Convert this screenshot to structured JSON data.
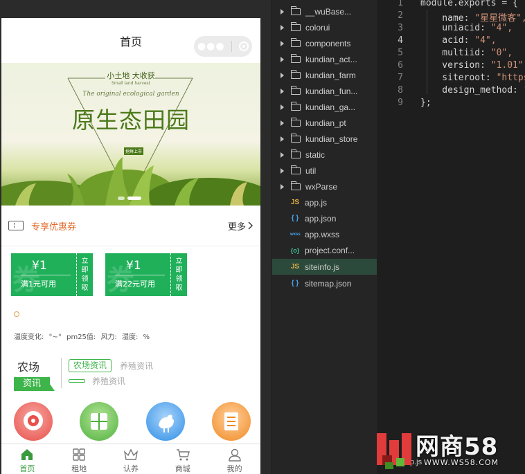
{
  "simulator": {
    "nav_title": "首页",
    "banner": {
      "slogan": "小土地 大收获",
      "slogan_en": "Small land harvest",
      "motto": "The original ecological garden",
      "main_title": "原生态田园",
      "tag": "抢鲜上市"
    },
    "coupon_section": {
      "label": "专享优惠券",
      "more": "更多"
    },
    "coupons": [
      {
        "amount": "¥1",
        "condition": "满1元可用",
        "action": [
          "立",
          "即",
          "领",
          "取"
        ]
      },
      {
        "amount": "¥1",
        "condition": "满22元可用",
        "action": [
          "立",
          "即",
          "领",
          "取"
        ]
      }
    ],
    "weather_line": "温度变化: °~° pm25值: 风力: 湿度: %",
    "news": {
      "brand_top": "农场",
      "brand_bottom": "资讯",
      "tag": "农场资讯",
      "row1": "养殖资讯",
      "row2": "养殖资讯"
    },
    "shortcut_icons": [
      "camera-icon",
      "grid-icon",
      "chicken-icon",
      "document-icon"
    ],
    "tabs": [
      {
        "label": "首页",
        "icon": "home-icon",
        "active": true
      },
      {
        "label": "租地",
        "icon": "grid-icon",
        "active": false
      },
      {
        "label": "认养",
        "icon": "crown-icon",
        "active": false
      },
      {
        "label": "商城",
        "icon": "cart-icon",
        "active": false
      },
      {
        "label": "我的",
        "icon": "user-icon",
        "active": false
      }
    ]
  },
  "file_tree": [
    {
      "name": "__wuBase...",
      "type": "folder"
    },
    {
      "name": "colorui",
      "type": "folder"
    },
    {
      "name": "components",
      "type": "folder"
    },
    {
      "name": "kundian_act...",
      "type": "folder"
    },
    {
      "name": "kundian_farm",
      "type": "folder"
    },
    {
      "name": "kundian_fun...",
      "type": "folder"
    },
    {
      "name": "kundian_ga...",
      "type": "folder"
    },
    {
      "name": "kundian_pt",
      "type": "folder"
    },
    {
      "name": "kundian_store",
      "type": "folder"
    },
    {
      "name": "static",
      "type": "folder"
    },
    {
      "name": "util",
      "type": "folder"
    },
    {
      "name": "wxParse",
      "type": "folder"
    },
    {
      "name": "app.js",
      "type": "js",
      "badge": "JS"
    },
    {
      "name": "app.json",
      "type": "json",
      "badge": "{ }"
    },
    {
      "name": "app.wxss",
      "type": "wxss",
      "badge": "wxss"
    },
    {
      "name": "project.conf...",
      "type": "config",
      "badge": "{o}"
    },
    {
      "name": "siteinfo.js",
      "type": "js",
      "badge": "JS",
      "selected": true
    },
    {
      "name": "sitemap.json",
      "type": "json",
      "badge": "{ }"
    }
  ],
  "editor": {
    "current_line": "4",
    "lines": [
      {
        "n": "1",
        "key": "module.exports = {",
        "val": ""
      },
      {
        "n": "2",
        "key": "    name: ",
        "val": "\"星星微客\","
      },
      {
        "n": "3",
        "key": "    uniacid: ",
        "val": "\"4\","
      },
      {
        "n": "4",
        "key": "    acid: ",
        "val": "\"4\","
      },
      {
        "n": "5",
        "key": "    multiid: ",
        "val": "\"0\","
      },
      {
        "n": "6",
        "key": "    version: ",
        "val": "\"1.01\","
      },
      {
        "n": "7",
        "key": "    siteroot: ",
        "val": "\"https"
      },
      {
        "n": "8",
        "key": "    design_method: ",
        "val": "\""
      },
      {
        "n": "9",
        "key": "};",
        "val": ""
      }
    ]
  },
  "watermark": {
    "name": "网商58",
    "url": "WWW.WS58.COM",
    "partial": "p.js"
  },
  "colors": {
    "accent_green": "#20b05a",
    "coupon_orange": "#e06c2c",
    "tab_active": "#3a9b3e",
    "string": "#ce9178"
  }
}
